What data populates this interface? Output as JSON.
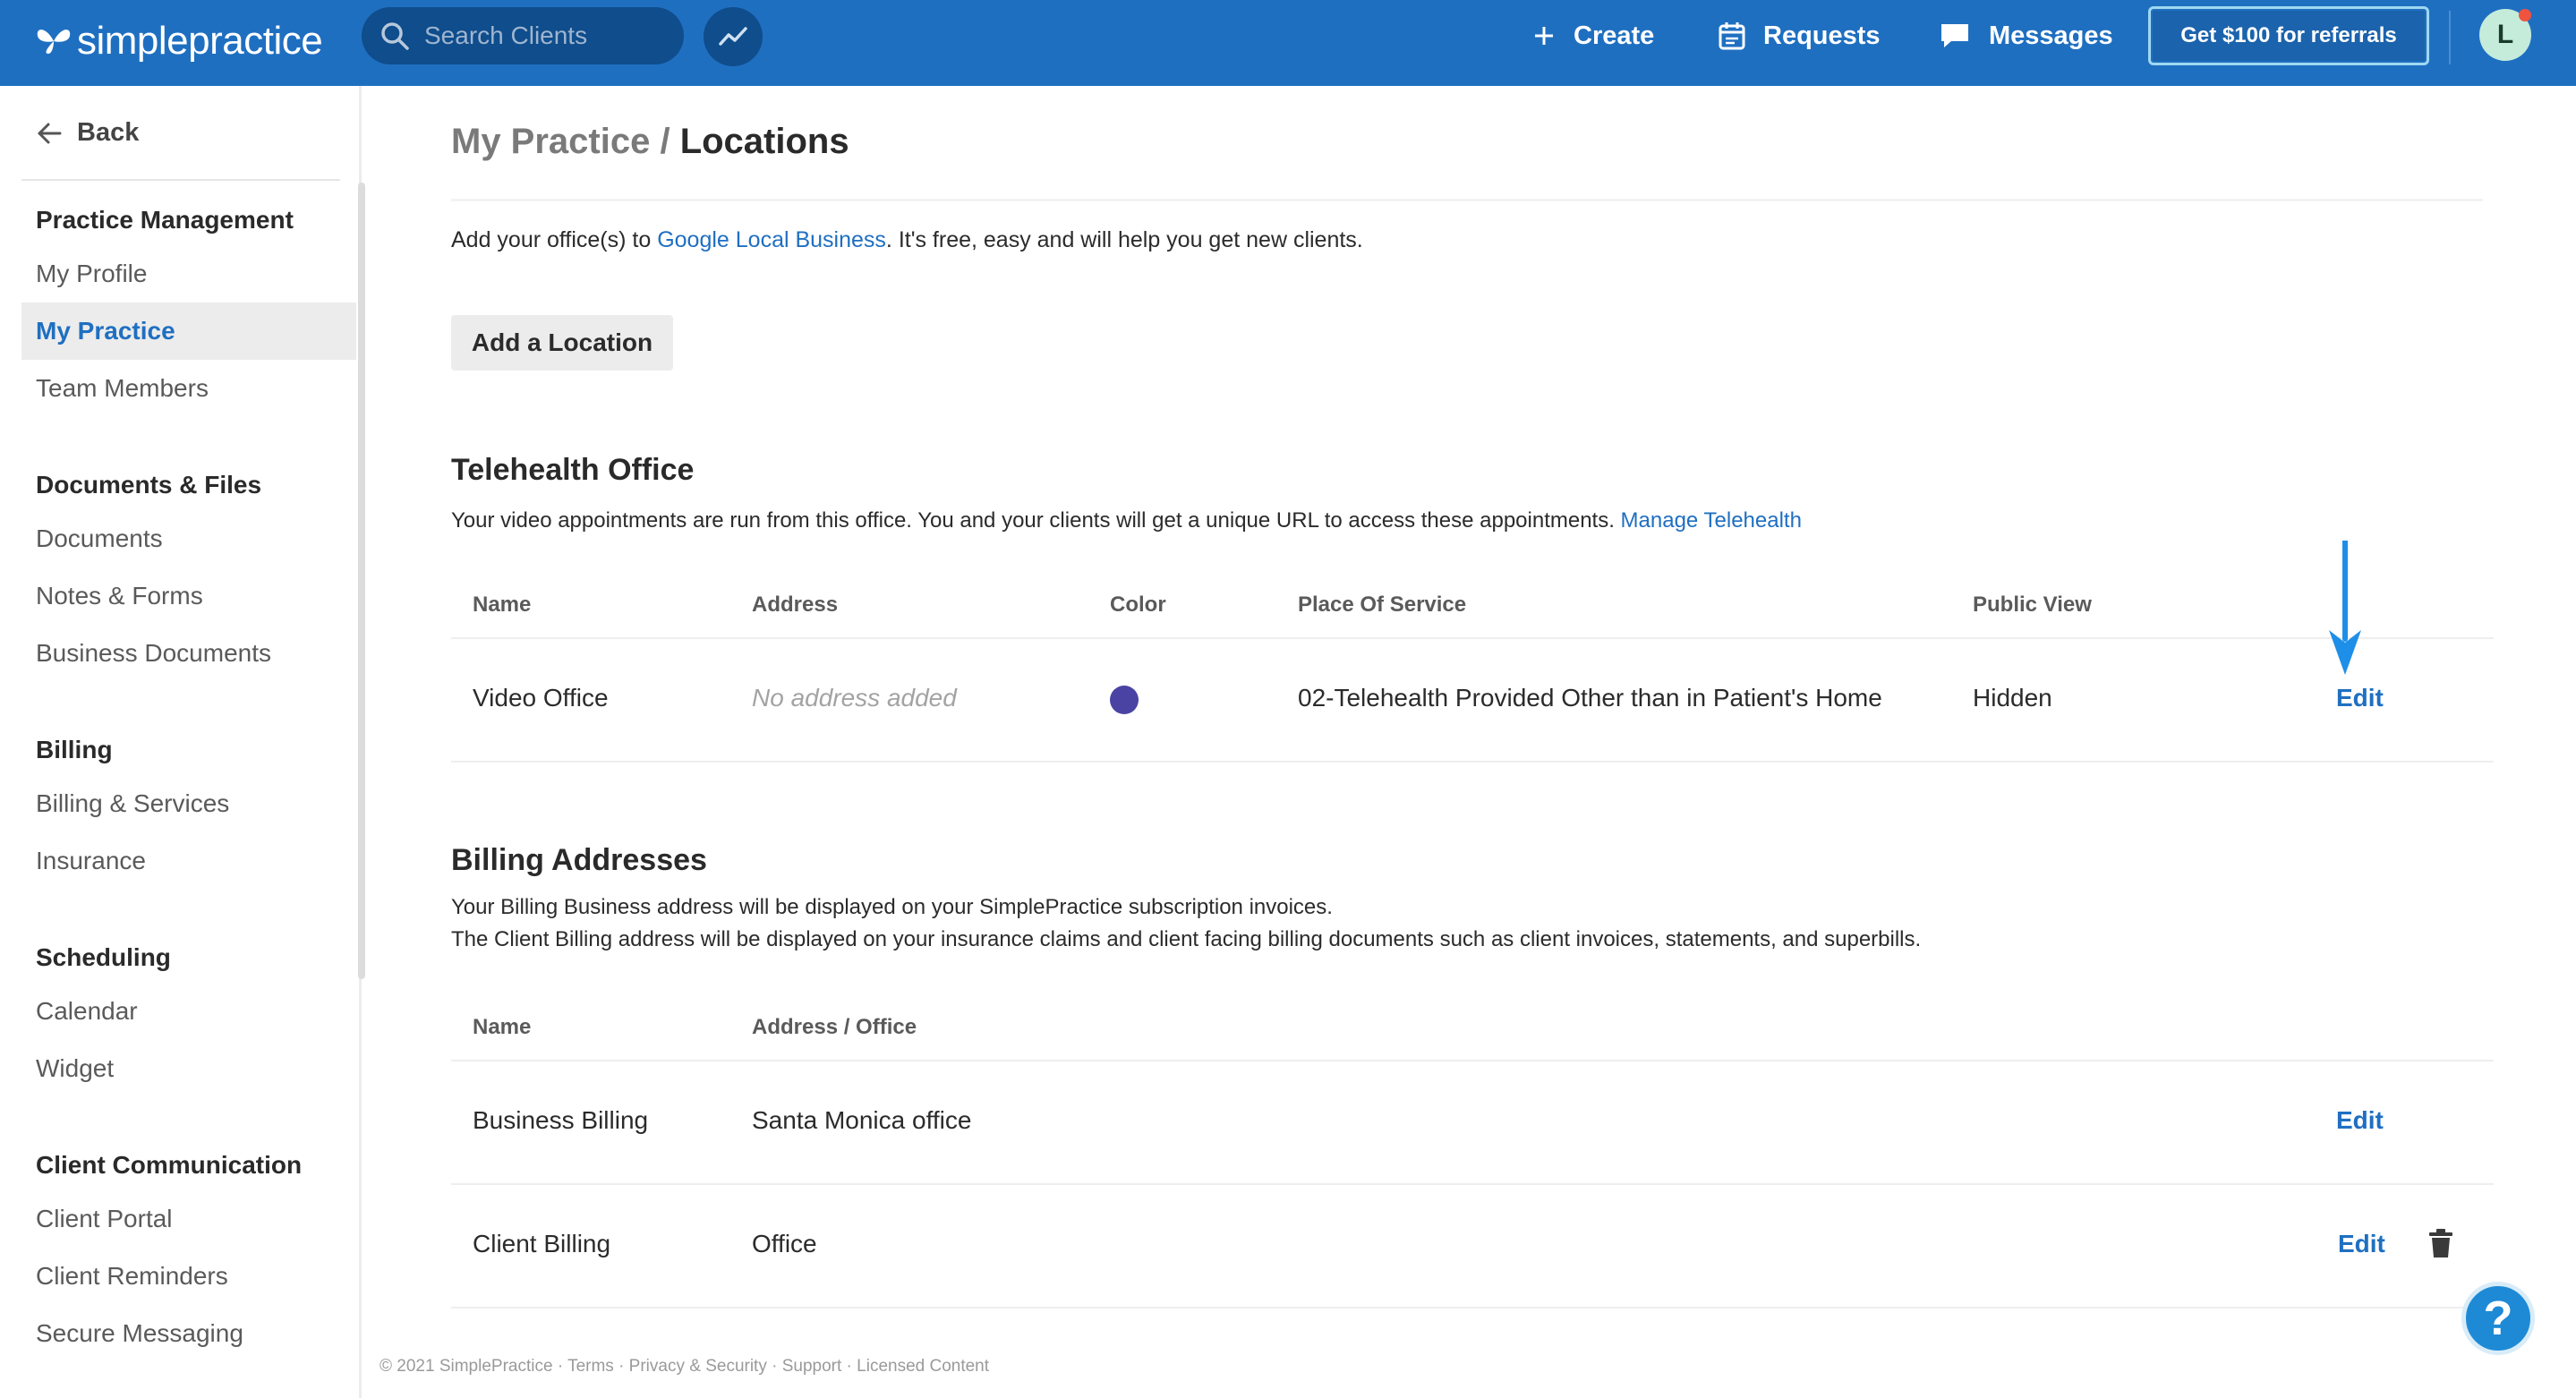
{
  "topbar": {
    "logo_text": "simplepractice",
    "search_placeholder": "Search Clients",
    "create_label": "Create",
    "requests_label": "Requests",
    "messages_label": "Messages",
    "referral_label": "Get $100 for referrals",
    "avatar_initial": "L",
    "brand_color": "#1f6fc1"
  },
  "sidebar": {
    "back_label": "Back",
    "groups": [
      {
        "heading": "Practice Management",
        "items": [
          "My Profile",
          "My Practice",
          "Team Members"
        ]
      },
      {
        "heading": "Documents & Files",
        "items": [
          "Documents",
          "Notes & Forms",
          "Business Documents"
        ]
      },
      {
        "heading": "Billing",
        "items": [
          "Billing & Services",
          "Insurance"
        ]
      },
      {
        "heading": "Scheduling",
        "items": [
          "Calendar",
          "Widget"
        ]
      },
      {
        "heading": "Client Communication",
        "items": [
          "Client Portal",
          "Client Reminders",
          "Secure Messaging"
        ]
      }
    ],
    "active_item": "My Practice"
  },
  "main": {
    "breadcrumb_parent": "My Practice",
    "breadcrumb_separator": " / ",
    "title": "Locations",
    "intro_prefix": "Add your office(s) to ",
    "intro_link": "Google Local Business",
    "intro_suffix": ". It's free, easy and will help you get new clients.",
    "add_location_label": "Add a Location",
    "telehealth": {
      "title": "Telehealth Office",
      "description": "Your video appointments are run from this office. You and your clients will get a unique URL to access these appointments. ",
      "manage_link": "Manage Telehealth",
      "columns": [
        "Name",
        "Address",
        "Color",
        "Place Of Service",
        "Public View"
      ],
      "row": {
        "name": "Video Office",
        "address": "No address added",
        "color": "#4b43a3",
        "place_of_service": "02-Telehealth Provided Other than in Patient's Home",
        "public_view": "Hidden",
        "edit_label": "Edit"
      }
    },
    "billing": {
      "title": "Billing Addresses",
      "description_line1": "Your Billing Business address will be displayed on your SimplePractice subscription invoices.",
      "description_line2": "The Client Billing address will be displayed on your insurance claims and client facing billing documents such as client invoices, statements, and superbills.",
      "columns": [
        "Name",
        "Address / Office"
      ],
      "rows": [
        {
          "name": "Business Billing",
          "address": "Santa Monica office",
          "edit_label": "Edit"
        },
        {
          "name": "Client Billing",
          "address": "Office",
          "edit_label": "Edit"
        }
      ]
    }
  },
  "footer": {
    "text": "© 2021 SimplePractice · Terms · Privacy & Security · Support · Licensed Content"
  },
  "help_label": "?"
}
